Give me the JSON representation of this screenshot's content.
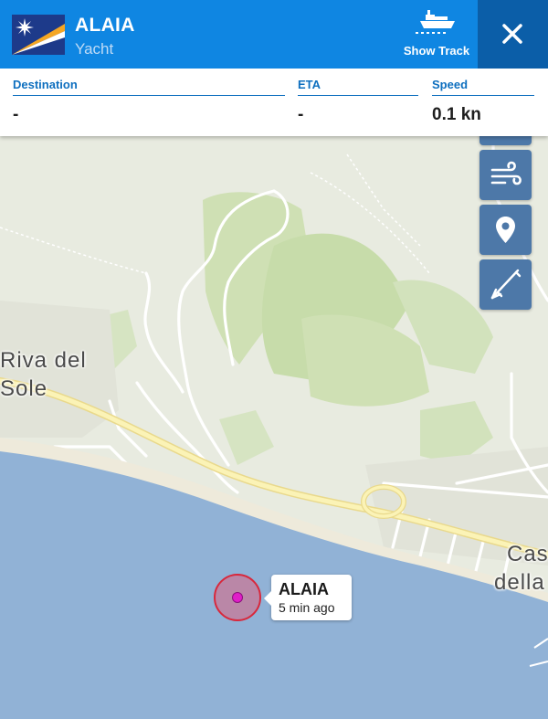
{
  "header": {
    "vessel_name": "ALAIA",
    "vessel_type": "Yacht",
    "show_track_label": "Show Track",
    "flag_icon": "marshall-islands-flag-icon",
    "colors": {
      "header_bg": "#0f86e2",
      "close_bg": "#0b5ea8"
    }
  },
  "info": {
    "destination_label": "Destination",
    "destination_value": "-",
    "eta_label": "ETA",
    "eta_value": "-",
    "speed_label": "Speed",
    "speed_value": "0.1 kn"
  },
  "map": {
    "places": [
      {
        "name": "Riva del Sole"
      },
      {
        "name": "Castiglione della Pescaia",
        "shown": "Cas della"
      }
    ],
    "place_riva_line1": "Riva del",
    "place_riva_line2": "Sole",
    "place_cas_line1": "Cas",
    "place_cas_line2": "della",
    "controls": [
      "wind-icon",
      "location-pin-icon",
      "ruler-icon"
    ]
  },
  "vessel_marker": {
    "name": "ALAIA",
    "last_seen": "5 min ago",
    "color": "#e01fc8"
  }
}
